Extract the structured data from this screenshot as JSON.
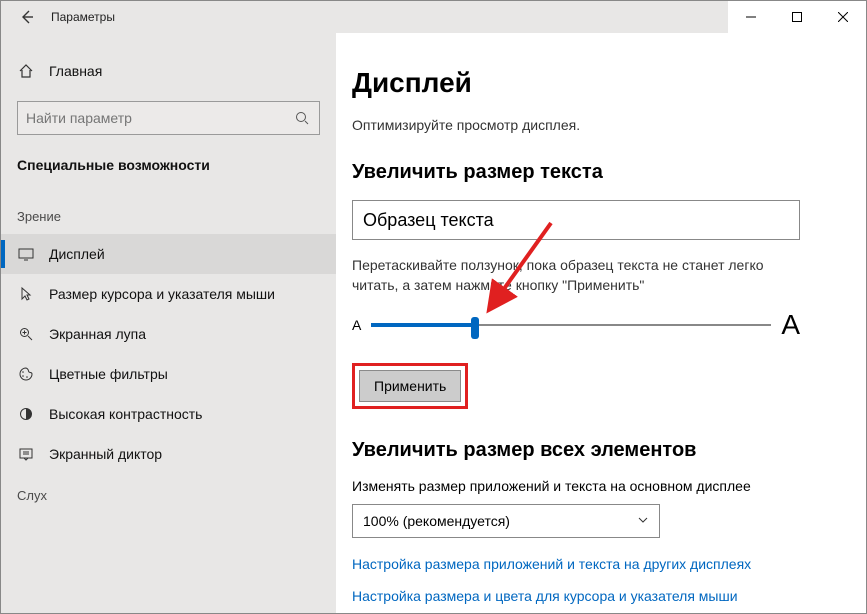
{
  "titlebar": {
    "title": "Параметры"
  },
  "sidebar": {
    "home_label": "Главная",
    "search_placeholder": "Найти параметр",
    "category": "Специальные возможности",
    "group_vision": "Зрение",
    "group_hearing": "Слух",
    "items": [
      {
        "label": "Дисплей"
      },
      {
        "label": "Размер курсора и указателя мыши"
      },
      {
        "label": "Экранная лупа"
      },
      {
        "label": "Цветные фильтры"
      },
      {
        "label": "Высокая контрастность"
      },
      {
        "label": "Экранный диктор"
      }
    ]
  },
  "main": {
    "heading": "Дисплей",
    "subheading": "Оптимизируйте просмотр дисплея.",
    "text_section_title": "Увеличить размер текста",
    "sample_text": "Образец текста",
    "instruction": "Перетаскивайте ползунок, пока образец текста не станет легко читать, а затем нажмите кнопку \"Применить\"",
    "slider_small": "A",
    "slider_big": "A",
    "apply_label": "Применить",
    "scale_section_title": "Увеличить размер всех элементов",
    "scale_label": "Изменять размер приложений и текста на основном дисплее",
    "scale_value": "100% (рекомендуется)",
    "link1": "Настройка размера приложений и текста на других дисплеях",
    "link2": "Настройка размера и цвета для курсора и указателя мыши"
  },
  "annotation": {
    "highlight_color": "#e02020"
  }
}
